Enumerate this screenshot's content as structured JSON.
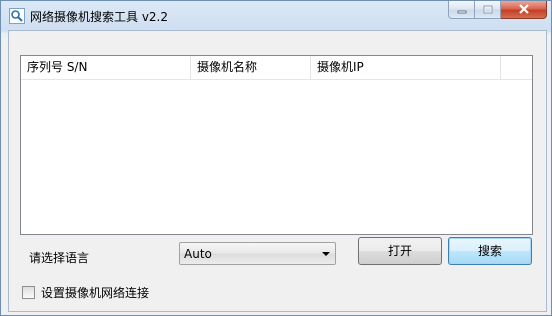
{
  "window": {
    "title": "网络摄像机搜索工具 v2.2",
    "icon": "magnifier-icon",
    "caption_buttons": [
      "minimize-icon",
      "maximize-icon",
      "close-icon"
    ]
  },
  "camera_list": {
    "columns": [
      "序列号 S/N",
      "摄像机名称",
      "摄像机IP"
    ],
    "rows": []
  },
  "language": {
    "label": "请选择语言",
    "selected": "Auto"
  },
  "buttons": {
    "open": "打开",
    "search": "搜索"
  },
  "network_setting": {
    "label": "设置摄像机网络连接",
    "checked": false
  },
  "colors": {
    "close_button": "#c63e27",
    "default_button_border": "#3c7fb1"
  }
}
